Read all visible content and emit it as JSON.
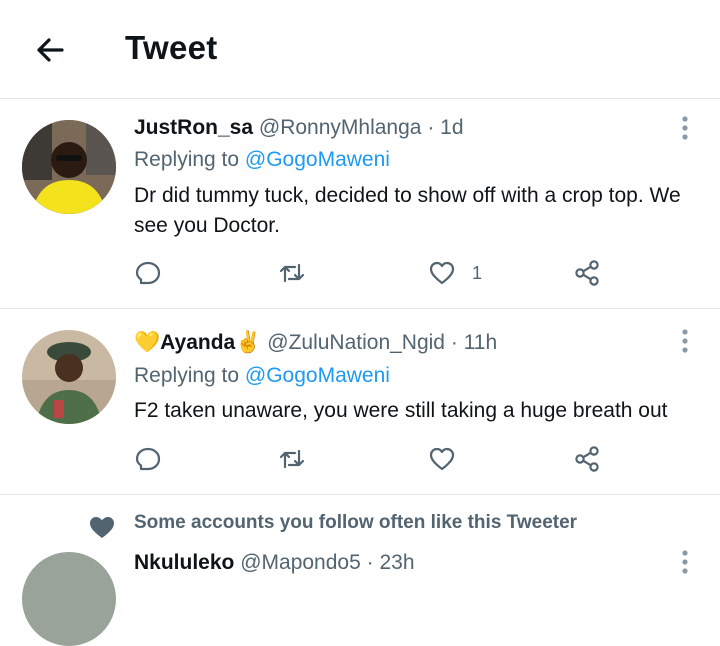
{
  "header": {
    "title": "Tweet"
  },
  "tweets": [
    {
      "name": "JustRon_sa",
      "handle": "@RonnyMhlanga",
      "separator": "·",
      "time": "1d",
      "replying_prefix": "Replying to",
      "replying_to": "@GogoMaweni",
      "text": "Dr did tummy tuck, decided to show off with a crop top. We see you Doctor.",
      "like_count": "1"
    },
    {
      "name_emoji_left": "💛",
      "name": "Ayanda",
      "name_emoji_right": "✌",
      "handle": "@ZuluNation_Ngid",
      "separator": "·",
      "time": "11h",
      "replying_prefix": "Replying to",
      "replying_to": "@GogoMaweni",
      "text": "F2 taken unaware, you were still taking a huge breath out",
      "like_count": ""
    }
  ],
  "social_context": "Some accounts you follow often like this Tweeter",
  "next_tweet": {
    "name": "Nkululeko",
    "handle": "@Mapondo5",
    "separator": "·",
    "time": "23h"
  },
  "icons": {
    "back": "arrow-left-icon",
    "reply": "comment-icon",
    "retweet": "retweet-icon",
    "like": "heart-icon",
    "share": "share-icon",
    "more": "more-vertical-icon"
  },
  "colors": {
    "link": "#1d9bf0",
    "muted": "#536471",
    "text": "#0f1419",
    "divider": "#e6e6e6"
  }
}
